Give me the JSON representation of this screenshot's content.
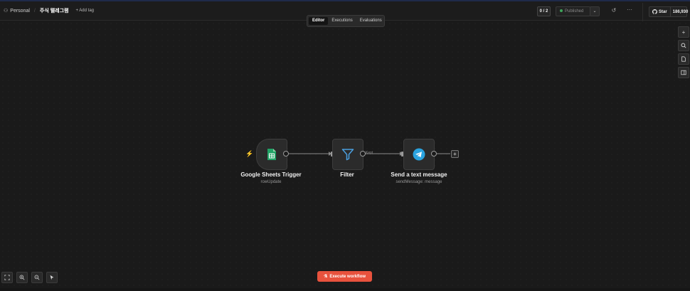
{
  "header": {
    "project": "Personal",
    "workflow_name": "주식 텔레그램",
    "add_tag": "+ Add tag",
    "counter": "0 / 2",
    "publish_label": "Published",
    "github_star": "Star",
    "github_count": "186,930"
  },
  "tabs": [
    {
      "label": "Editor"
    },
    {
      "label": "Executions"
    },
    {
      "label": "Evaluations"
    }
  ],
  "nodes": [
    {
      "title": "Google Sheets Trigger",
      "subtitle": "rowUpdate",
      "icon": "google-sheets-icon"
    },
    {
      "title": "Filter",
      "subtitle": "",
      "icon": "filter-funnel-icon"
    },
    {
      "title": "Send a text message",
      "subtitle": "sendMessage: message",
      "icon": "telegram-icon"
    }
  ],
  "connection_label": "Kept",
  "execute_button": "Execute workflow",
  "colors": {
    "accent": "#e8523d",
    "sheets_green": "#21a366",
    "filter_blue": "#4a9fe0",
    "telegram_blue": "#2aa3df",
    "published_dot": "#3fa45b"
  }
}
